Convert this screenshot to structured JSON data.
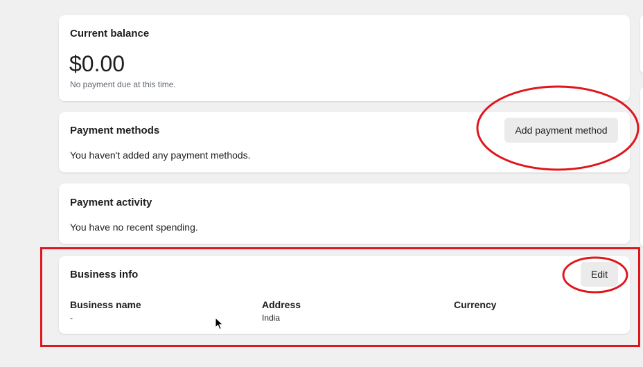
{
  "current_balance": {
    "title": "Current balance",
    "amount": "$0.00",
    "note": "No payment due at this time."
  },
  "payment_methods": {
    "title": "Payment methods",
    "button_label": "Add payment method",
    "empty_text": "You haven't added any payment methods."
  },
  "payment_activity": {
    "title": "Payment activity",
    "empty_text": "You have no recent spending."
  },
  "business_info": {
    "title": "Business info",
    "edit_label": "Edit",
    "columns": [
      {
        "label": "Business name",
        "value": "-"
      },
      {
        "label": "Address",
        "value": "India"
      },
      {
        "label": "Currency",
        "value": ""
      }
    ]
  },
  "colors": {
    "page_background": "#f0f0f0",
    "card_background": "#ffffff",
    "button_background": "#ebebeb",
    "annotation_red": "#e0161d"
  }
}
